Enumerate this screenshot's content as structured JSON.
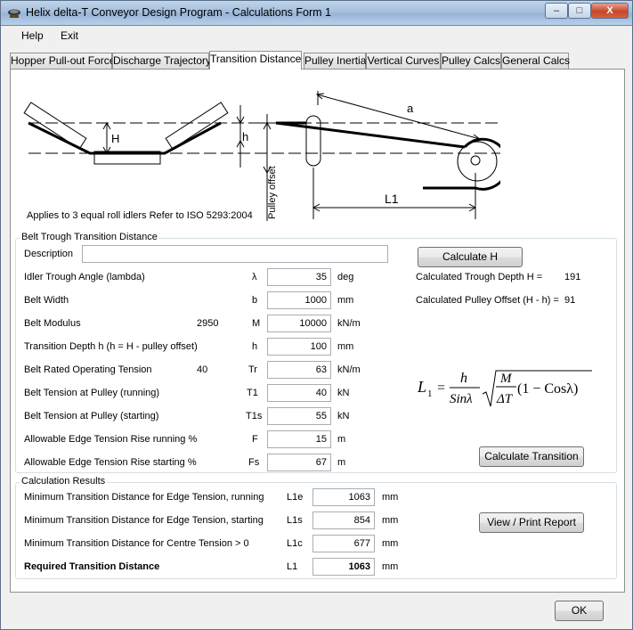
{
  "window": {
    "title": "Helix delta-T Conveyor Design Program - Calculations Form 1",
    "minimize_glyph": "–",
    "maximize_glyph": "□",
    "close_glyph": "X"
  },
  "menu": {
    "items": [
      {
        "label": "Help"
      },
      {
        "label": "Exit"
      }
    ]
  },
  "tabs": [
    {
      "label": "Hopper Pull-out Force"
    },
    {
      "label": "Discharge Trajectory"
    },
    {
      "label": "Transition Distance",
      "active": true
    },
    {
      "label": "Pulley Inertia"
    },
    {
      "label": "Vertical Curves"
    },
    {
      "label": "Pulley Calcs"
    },
    {
      "label": "General Calcs"
    }
  ],
  "diagram": {
    "label_H": "H",
    "label_h": "h",
    "label_a": "a",
    "label_L1": "L1",
    "label_pulley_offset": "Pulley offset",
    "applies_text": "Applies to 3 equal roll idlers Refer to ISO 5293:2004"
  },
  "transition_group": {
    "title": "Belt Trough Transition Distance",
    "description_label": "Description",
    "description_value": "",
    "rows": [
      {
        "label": "Idler Trough Angle (lambda)",
        "extra": "",
        "symbol": "λ",
        "value": "35",
        "unit": "deg"
      },
      {
        "label": "Belt Width",
        "extra": "",
        "symbol": "b",
        "value": "1000",
        "unit": "mm"
      },
      {
        "label": "Belt Modulus",
        "extra": "2950",
        "symbol": "M",
        "value": "10000",
        "unit": "kN/m"
      },
      {
        "label": "Transition Depth h (h = H - pulley offset)",
        "extra": "",
        "symbol": "h",
        "value": "100",
        "unit": "mm"
      },
      {
        "label": "Belt Rated Operating Tension",
        "extra": "40",
        "symbol": "Tr",
        "value": "63",
        "unit": "kN/m"
      },
      {
        "label": "Belt Tension at Pulley (running)",
        "extra": "",
        "symbol": "T1",
        "value": "40",
        "unit": "kN"
      },
      {
        "label": "Belt Tension at Pulley (starting)",
        "extra": "",
        "symbol": "T1s",
        "value": "55",
        "unit": "kN"
      },
      {
        "label": "Allowable Edge Tension Rise running %",
        "extra": "",
        "symbol": "F",
        "value": "15",
        "unit": "m"
      },
      {
        "label": "Allowable Edge Tension Rise starting %",
        "extra": "",
        "symbol": "Fs",
        "value": "67",
        "unit": "m"
      }
    ],
    "calculate_h_label": "Calculate H",
    "calc_trough_depth_label": "Calculated Trough Depth H =",
    "calc_trough_depth_value": "191",
    "calc_pulley_offset_label": "Calculated Pulley Offset (H - h) =",
    "calc_pulley_offset_value": "91",
    "calculate_transition_label": "Calculate Transition"
  },
  "formula": {
    "lhs": "L",
    "lhs_sub": "1",
    "eq": "=",
    "num_h": "h",
    "den_sin": "Sinλ",
    "num_M": "M",
    "den_dT": "ΔT",
    "tail": "(1 − Cosλ)"
  },
  "results_group": {
    "title": "Calculation Results",
    "rows": [
      {
        "label": "Minimum Transition Distance for Edge Tension, running",
        "symbol": "L1e",
        "value": "1063",
        "unit": "mm",
        "bold": false
      },
      {
        "label": "Minimum Transition Distance for Edge Tension, starting",
        "symbol": "L1s",
        "value": "854",
        "unit": "mm",
        "bold": false
      },
      {
        "label": "Minimum Transition Distance for Centre Tension > 0",
        "symbol": "L1c",
        "value": "677",
        "unit": "mm",
        "bold": false
      },
      {
        "label": "Required Transition Distance",
        "symbol": "L1",
        "value": "1063",
        "unit": "mm",
        "bold": true
      }
    ],
    "report_button_label": "View / Print Report"
  },
  "footer": {
    "ok_label": "OK"
  }
}
